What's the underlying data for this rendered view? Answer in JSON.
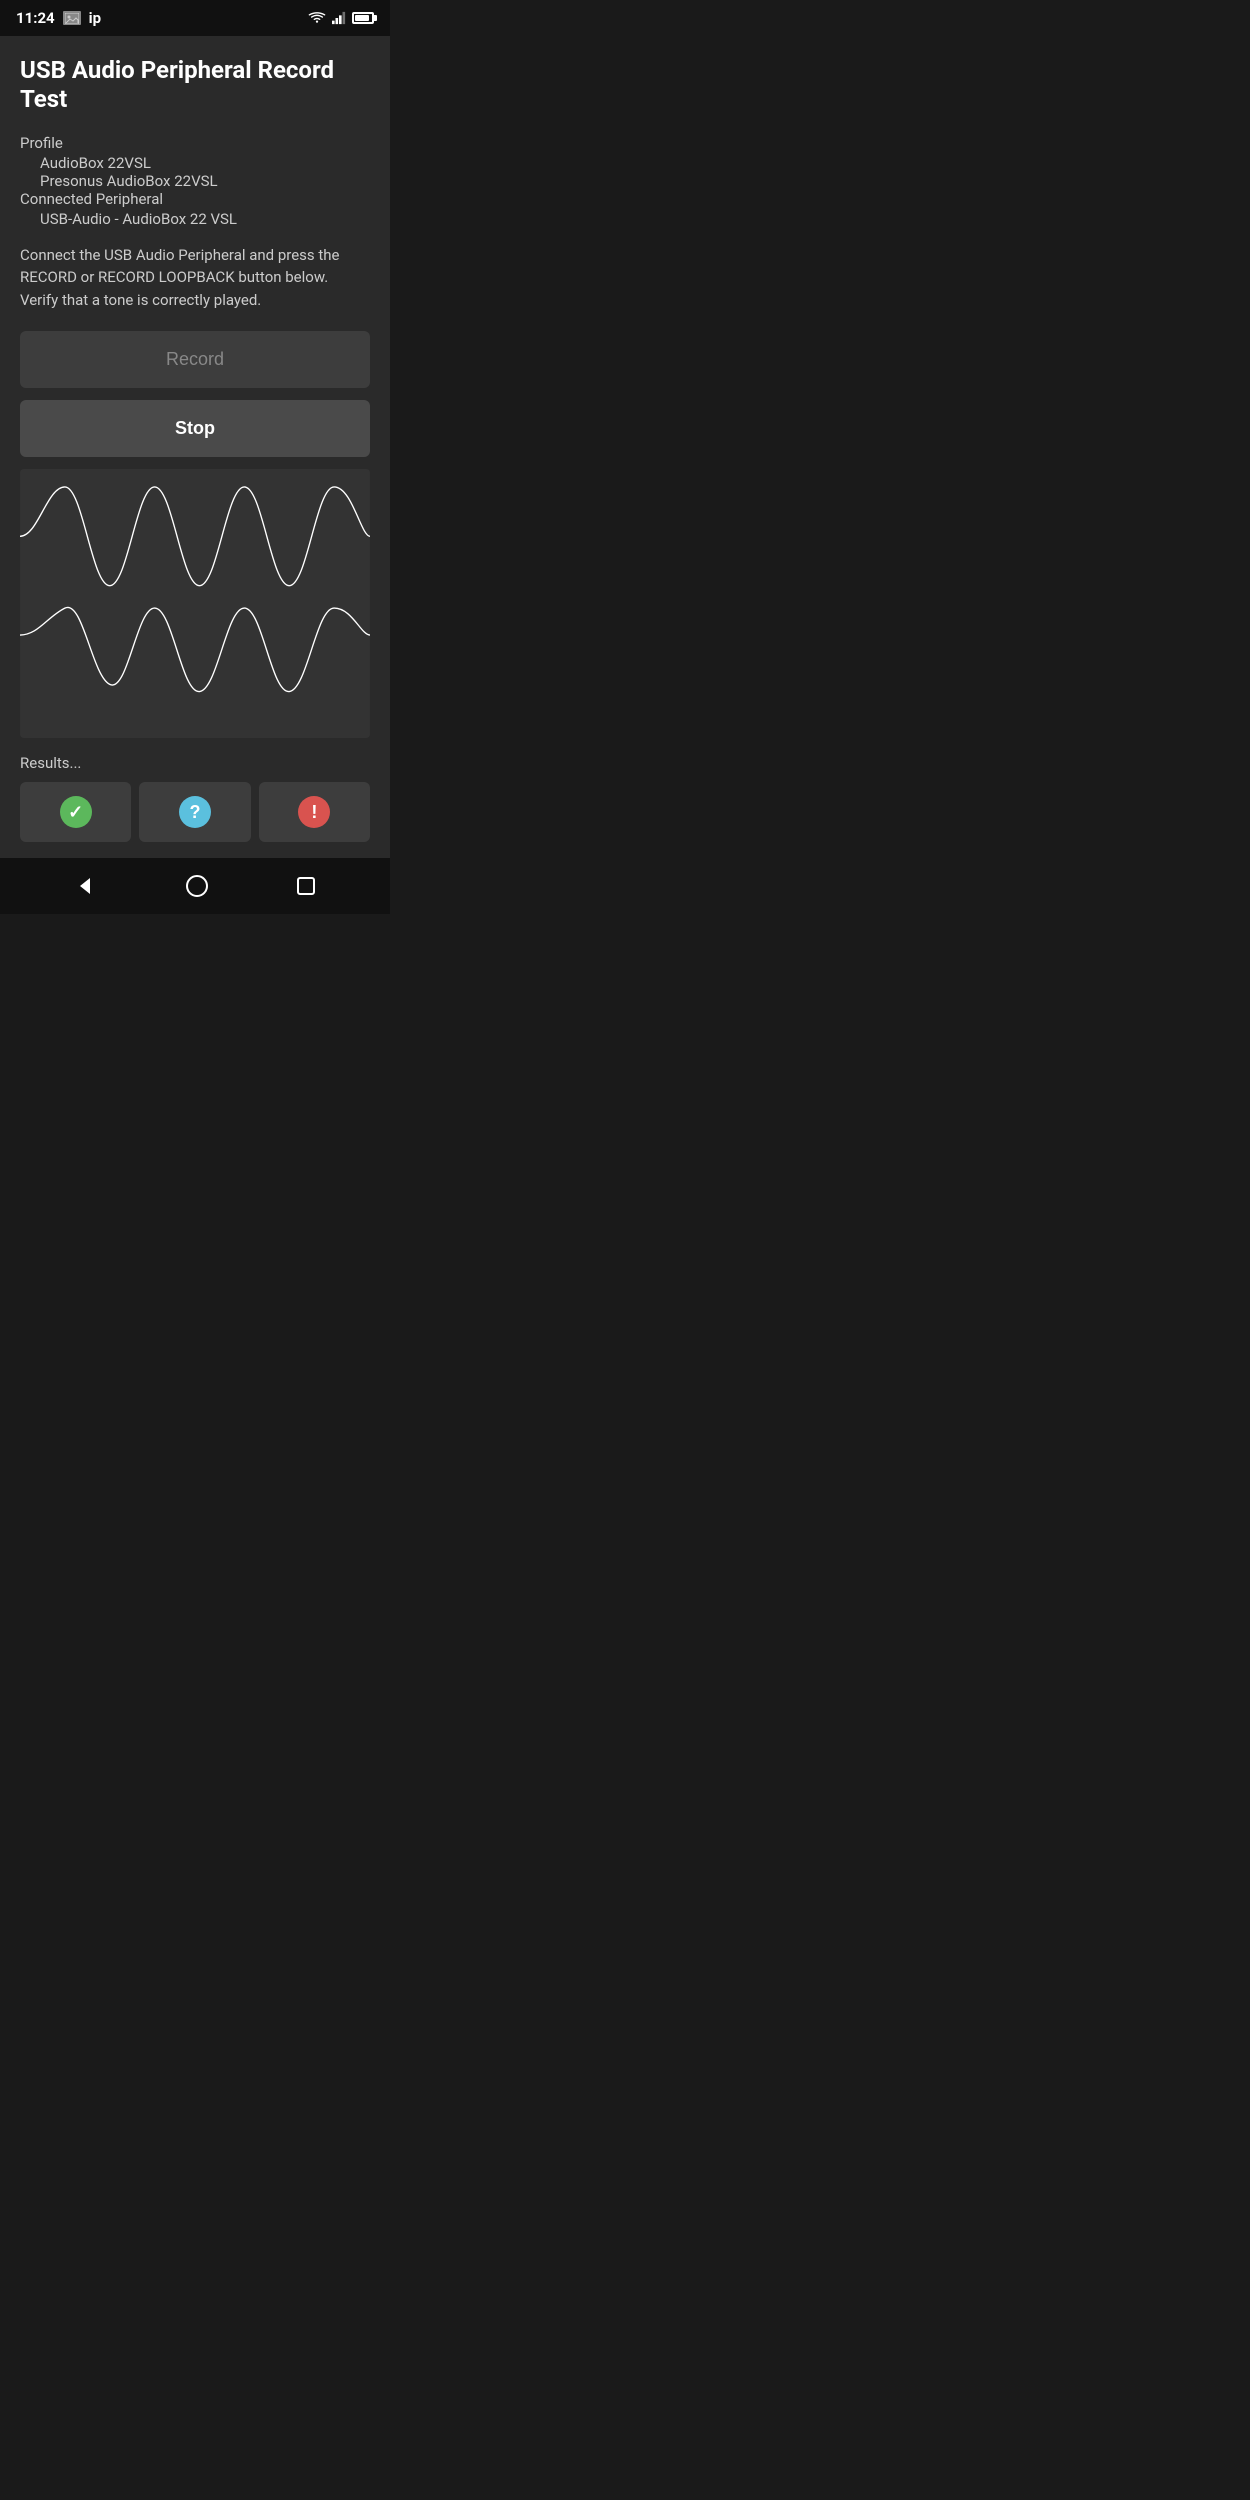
{
  "statusBar": {
    "time": "11:24",
    "label": "ip"
  },
  "header": {
    "title": "USB Audio Peripheral Record Test"
  },
  "profile": {
    "label": "Profile",
    "line1": "AudioBox 22VSL",
    "line2": "Presonus AudioBox 22VSL",
    "connectedLabel": "Connected Peripheral",
    "connectedValue": "USB-Audio - AudioBox 22 VSL"
  },
  "instruction": "Connect the USB Audio Peripheral and press the RECORD or RECORD LOOPBACK button below. Verify that a tone is correctly played.",
  "buttons": {
    "record": "Record",
    "stop": "Stop"
  },
  "results": {
    "label": "Results..."
  },
  "resultButtons": [
    {
      "type": "success",
      "icon": "✓",
      "color": "green"
    },
    {
      "type": "help",
      "icon": "?",
      "color": "blue"
    },
    {
      "type": "error",
      "icon": "!",
      "color": "red"
    }
  ]
}
